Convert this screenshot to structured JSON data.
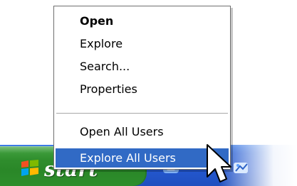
{
  "taskbar": {
    "start_label": "start",
    "icons": [
      "windows-logo-icon",
      "tray-app-icon",
      "tray-app-icon"
    ]
  },
  "context_menu": {
    "items": [
      {
        "label": "Open",
        "bold": true
      },
      {
        "label": "Explore"
      },
      {
        "label": "Search..."
      },
      {
        "label": "Properties"
      },
      {
        "label": "Open All Users"
      },
      {
        "label": "Explore All Users",
        "selected": true
      }
    ]
  },
  "colors": {
    "taskbar_blue": "#245DDA",
    "start_green": "#2E8D2C",
    "menu_highlight": "#316AC5",
    "menu_text": "#000000",
    "menu_text_selected": "#FFFFFF"
  }
}
